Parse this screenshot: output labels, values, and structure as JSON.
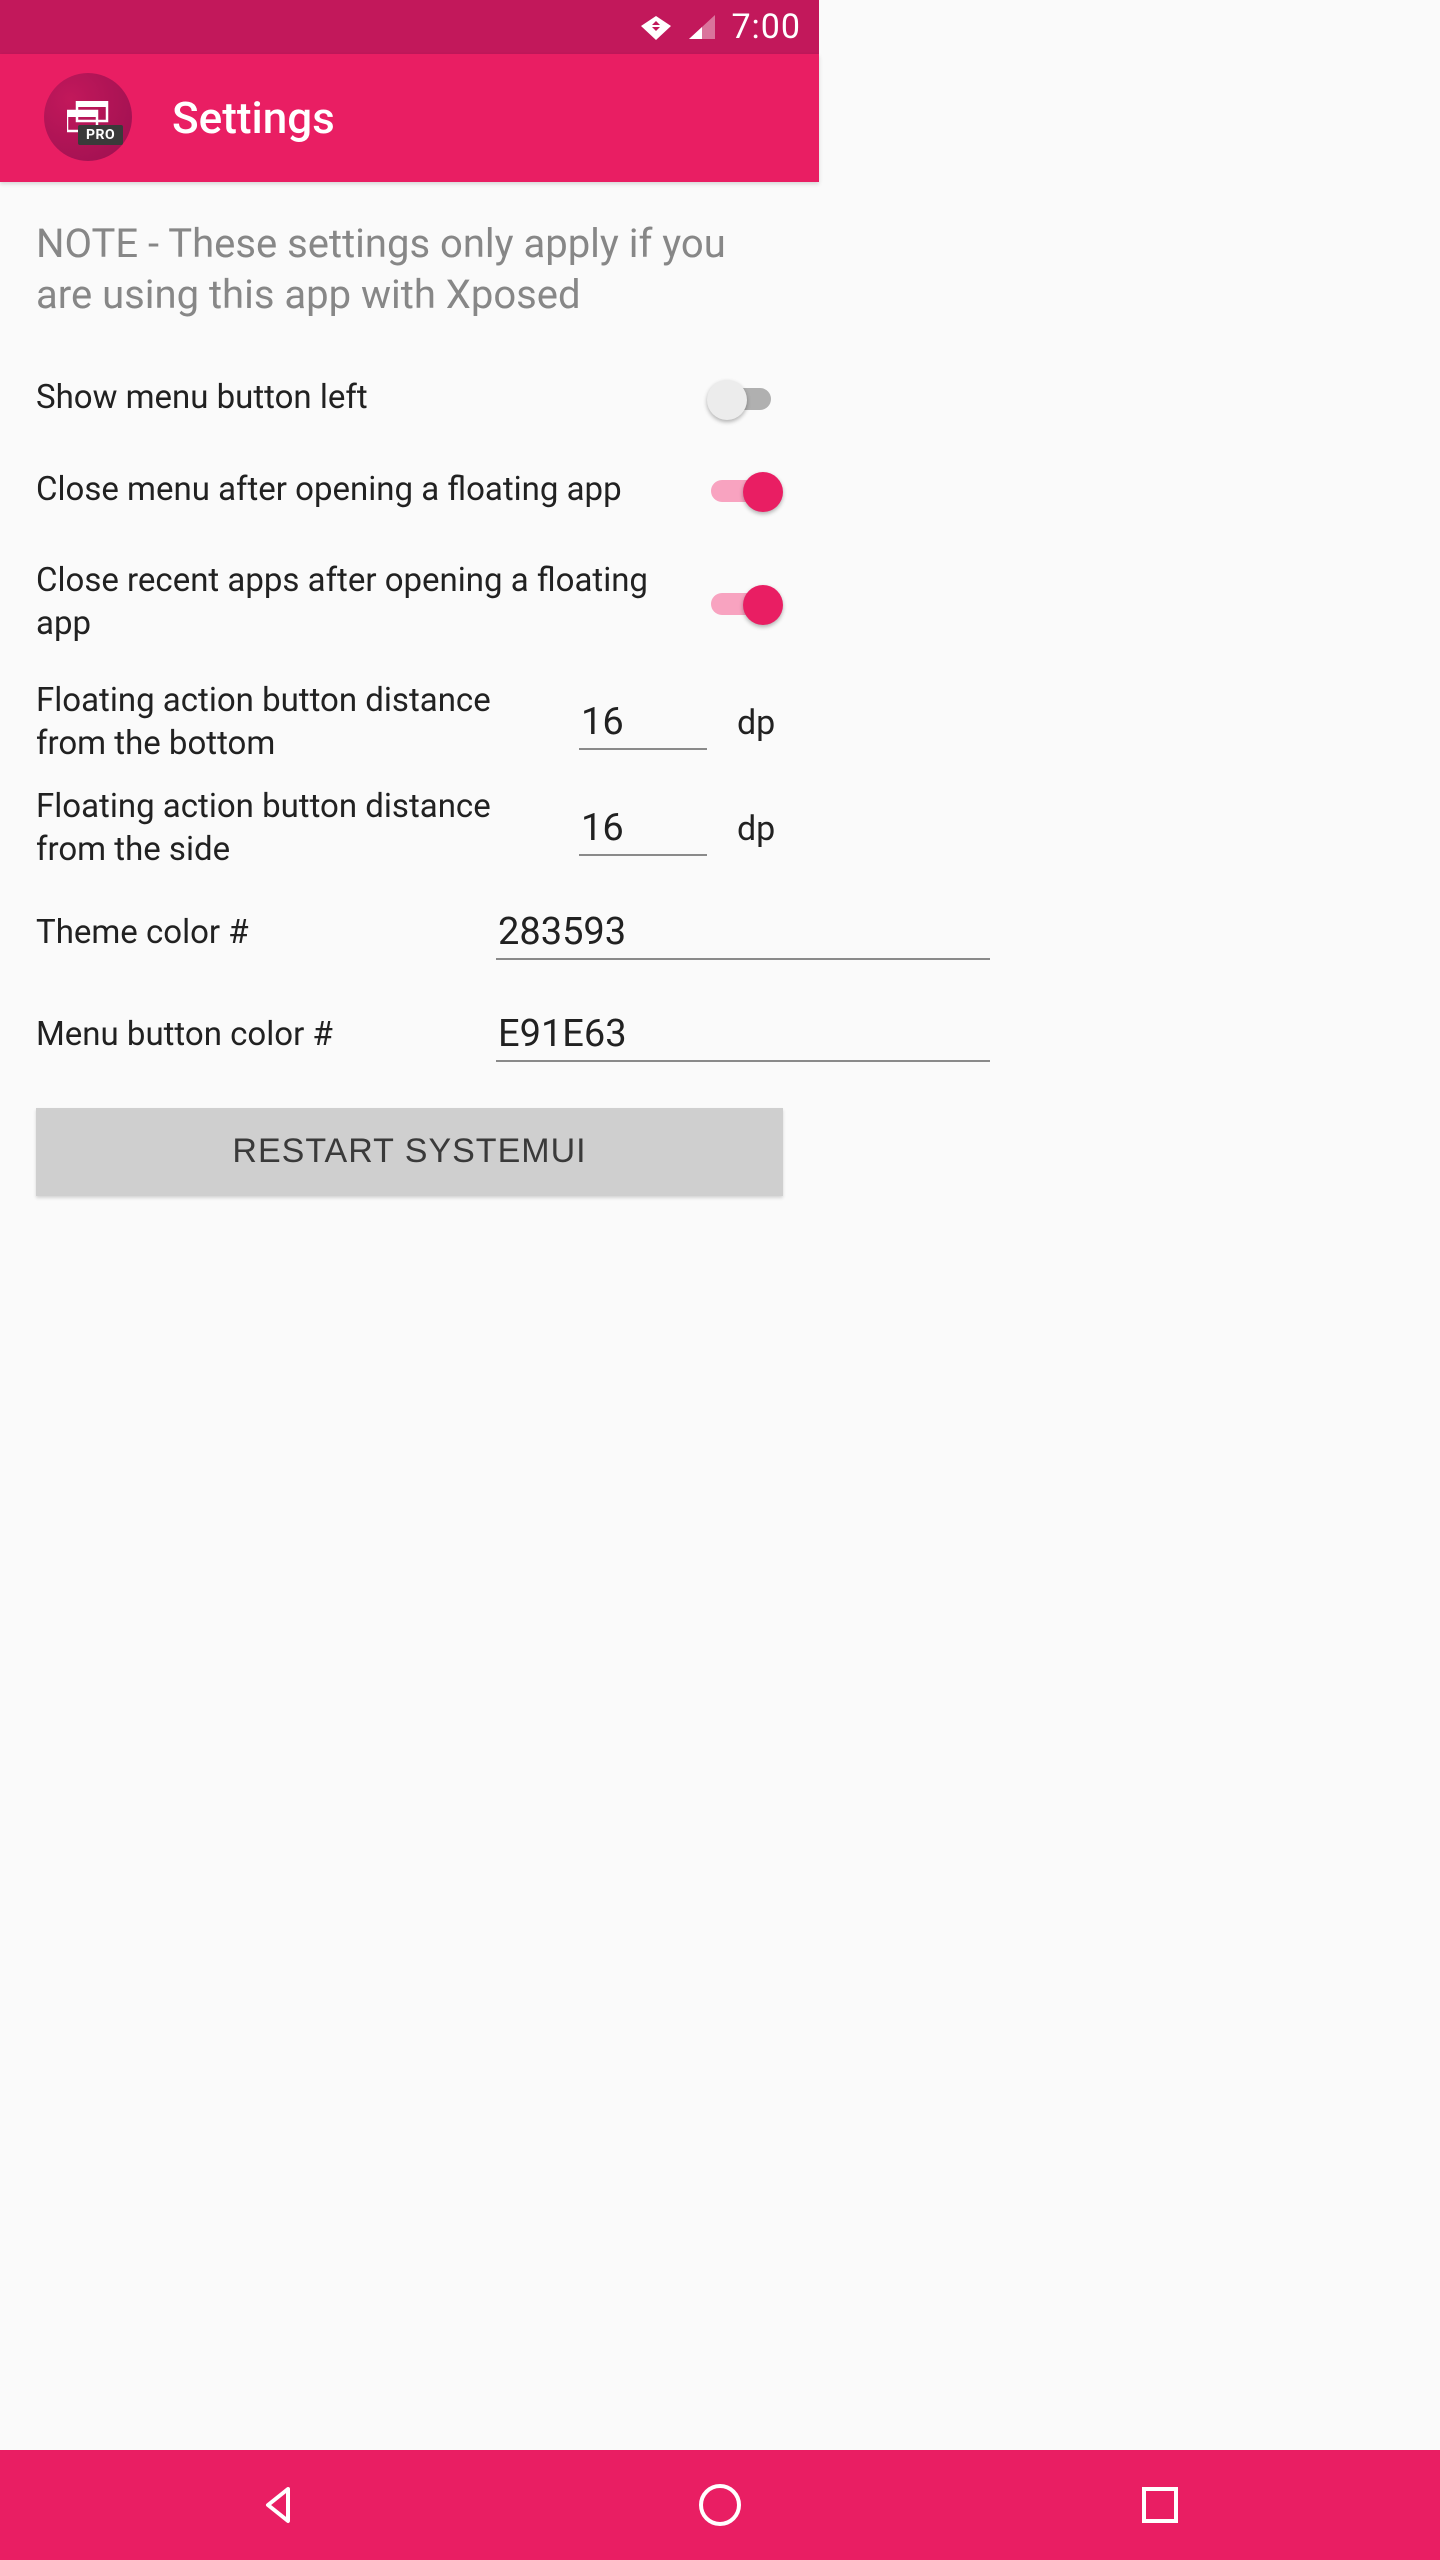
{
  "status": {
    "time": "7:00"
  },
  "appbar": {
    "pro_badge": "PRO",
    "title": "Settings"
  },
  "content": {
    "note": "NOTE - These settings only apply if you are using this app with Xposed",
    "settings": {
      "show_menu_left": {
        "label": "Show menu button left",
        "on": false
      },
      "close_menu_after": {
        "label": "Close menu after opening a floating app",
        "on": true
      },
      "close_recent_after": {
        "label": "Close recent apps after opening a floating app",
        "on": true
      },
      "fab_bottom": {
        "label": "Floating action button distance from the bottom",
        "value": "16",
        "unit": "dp"
      },
      "fab_side": {
        "label": "Floating action button distance from the side",
        "value": "16",
        "unit": "dp"
      },
      "theme_color": {
        "label": "Theme color #",
        "value": "283593"
      },
      "menu_color": {
        "label": "Menu button color #",
        "value": "E91E63"
      }
    },
    "restart_button": "RESTART SYSTEMUI"
  },
  "colors": {
    "primary": "#e91e63",
    "primary_dark": "#c2185b"
  }
}
